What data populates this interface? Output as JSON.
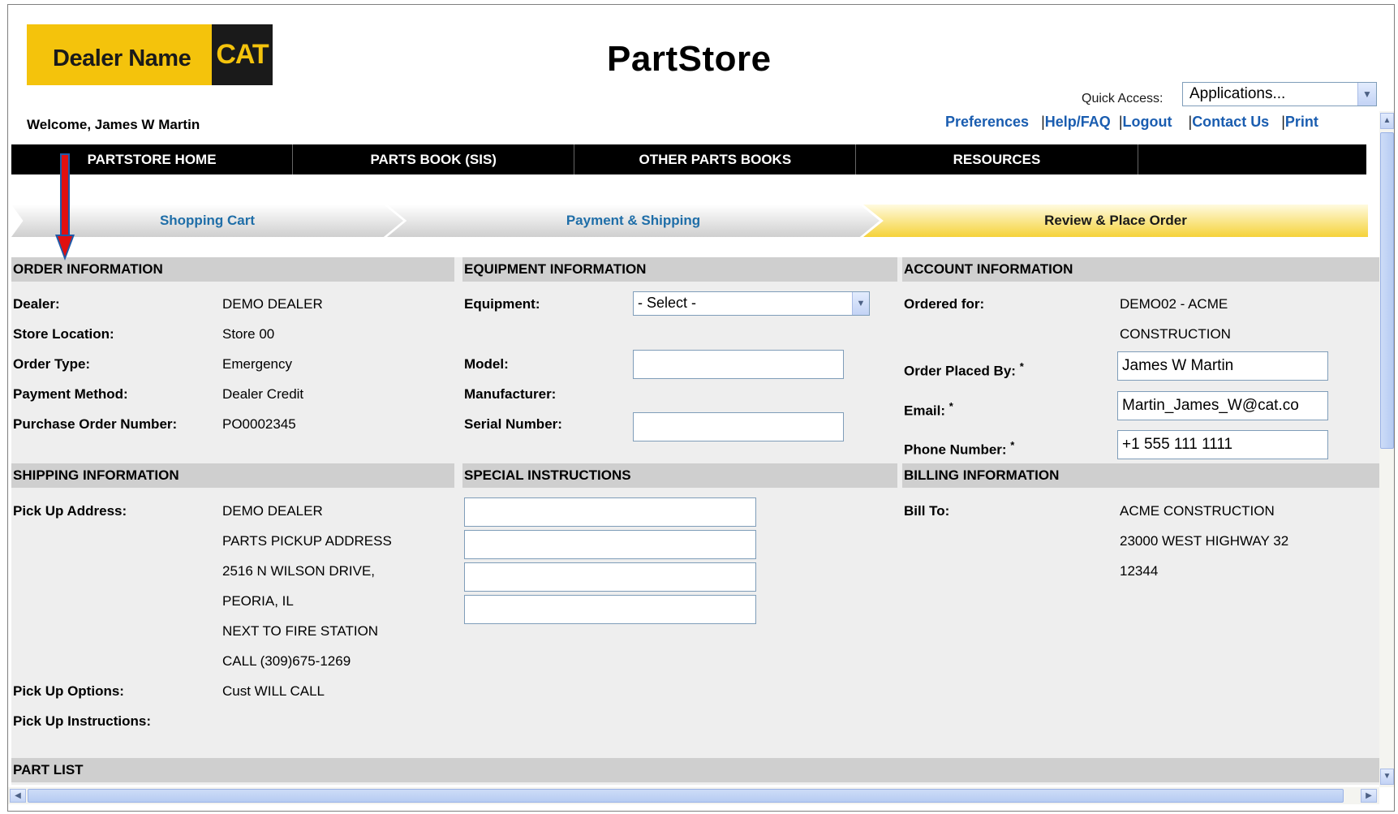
{
  "header": {
    "dealer_logo_text": "Dealer Name",
    "cat_logo_text": "CAT",
    "title": "PartStore",
    "welcome": "Welcome, James W Martin",
    "quick_access_label": "Quick Access:",
    "quick_access_value": "Applications...",
    "links": {
      "preferences": "Preferences",
      "help": "Help/FAQ",
      "logout": "Logout",
      "contact": "Contact Us",
      "print": "Print"
    }
  },
  "nav": {
    "items": [
      "PARTSTORE HOME",
      "PARTS BOOK  (SIS)",
      "OTHER PARTS BOOKS",
      "RESOURCES"
    ]
  },
  "steps": {
    "cart": "Shopping Cart",
    "payment": "Payment & Shipping",
    "review": "Review & Place Order"
  },
  "order_info": {
    "heading": "ORDER INFORMATION",
    "dealer_label": "Dealer:",
    "dealer_value": "DEMO DEALER",
    "store_label": "Store Location:",
    "store_value": "Store 00",
    "type_label": "Order Type:",
    "type_value": "Emergency",
    "payment_label": "Payment Method:",
    "payment_value": "Dealer Credit",
    "po_label": "Purchase Order Number:",
    "po_value": "PO0002345"
  },
  "equipment_info": {
    "heading": "EQUIPMENT INFORMATION",
    "equipment_label": "Equipment:",
    "equipment_value": "- Select -",
    "model_label": "Model:",
    "model_value": "",
    "manufacturer_label": "Manufacturer:",
    "serial_label": "Serial Number:",
    "serial_value": ""
  },
  "account_info": {
    "heading": "ACCOUNT INFORMATION",
    "ordered_for_label": "Ordered for:",
    "ordered_for_line1": "DEMO02 - ACME",
    "ordered_for_line2": "CONSTRUCTION",
    "placed_by_label": "Order Placed By:",
    "placed_by_value": "James W Martin",
    "email_label": "Email:",
    "email_value": "Martin_James_W@cat.co",
    "phone_label": "Phone Number:",
    "phone_value": "+1 555 111 1111",
    "required_mark": "*"
  },
  "shipping_info": {
    "heading": "SHIPPING INFORMATION",
    "pickup_address_label": "Pick Up Address:",
    "address_lines": [
      "DEMO DEALER",
      "PARTS PICKUP ADDRESS",
      "2516 N WILSON DRIVE,",
      "PEORIA, IL",
      "NEXT TO FIRE STATION",
      "CALL (309)675-1269"
    ],
    "pickup_options_label": "Pick Up Options:",
    "pickup_options_value": "Cust WILL CALL",
    "pickup_instructions_label": "Pick Up Instructions:"
  },
  "special_instructions": {
    "heading": "SPECIAL INSTRUCTIONS",
    "lines": [
      "",
      "",
      "",
      ""
    ]
  },
  "billing_info": {
    "heading": "BILLING INFORMATION",
    "bill_to_label": "Bill To:",
    "bill_to_lines": [
      "ACME CONSTRUCTION",
      "23000 WEST HIGHWAY 32",
      "12344"
    ]
  },
  "part_list": {
    "heading": "PART LIST"
  },
  "colors": {
    "brand_yellow": "#f4c30c",
    "link_blue": "#1a5db0",
    "step_active": "#f5d23a",
    "annotation_red": "#e01010",
    "annotation_blue": "#1f5aa8"
  },
  "icons": {
    "annotation": "down-arrow-icon"
  }
}
